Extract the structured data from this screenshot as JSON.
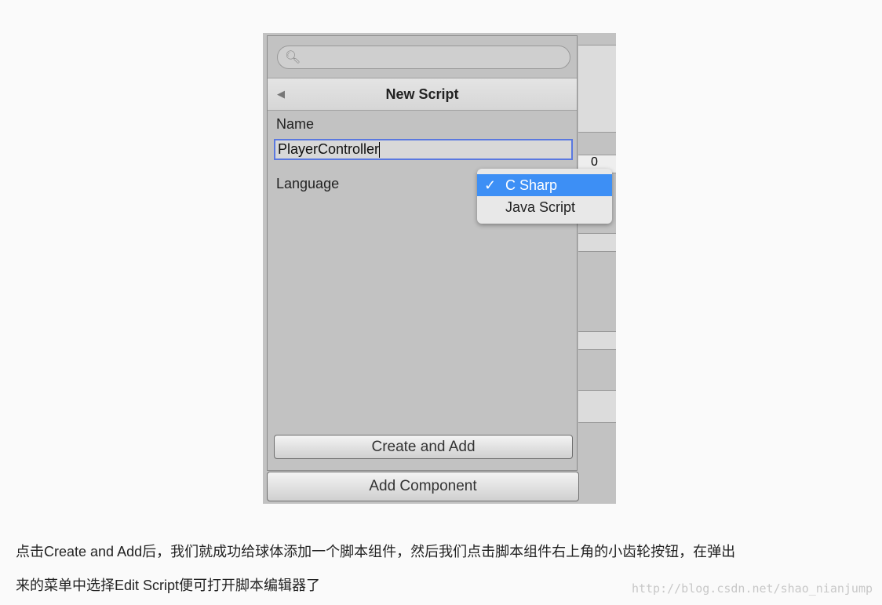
{
  "screenshot": {
    "header_title": "New Script",
    "name_label": "Name",
    "name_value": "PlayerController",
    "language_label": "Language",
    "language_options": [
      {
        "label": "C Sharp",
        "selected": true
      },
      {
        "label": "Java Script",
        "selected": false
      }
    ],
    "check_mark": "✓",
    "create_button": "Create and Add",
    "add_component_button": "Add Component",
    "bg_field_value": "0",
    "accent": "#3d8ff5"
  },
  "article": {
    "line1": "点击Create and Add后，我们就成功给球体添加一个脚本组件，然后我们点击脚本组件右上角的小齿轮按钮，在弹出",
    "line2": "来的菜单中选择Edit Script便可打开脚本编辑器了"
  },
  "watermark": "http://blog.csdn.net/shao_nianjump"
}
